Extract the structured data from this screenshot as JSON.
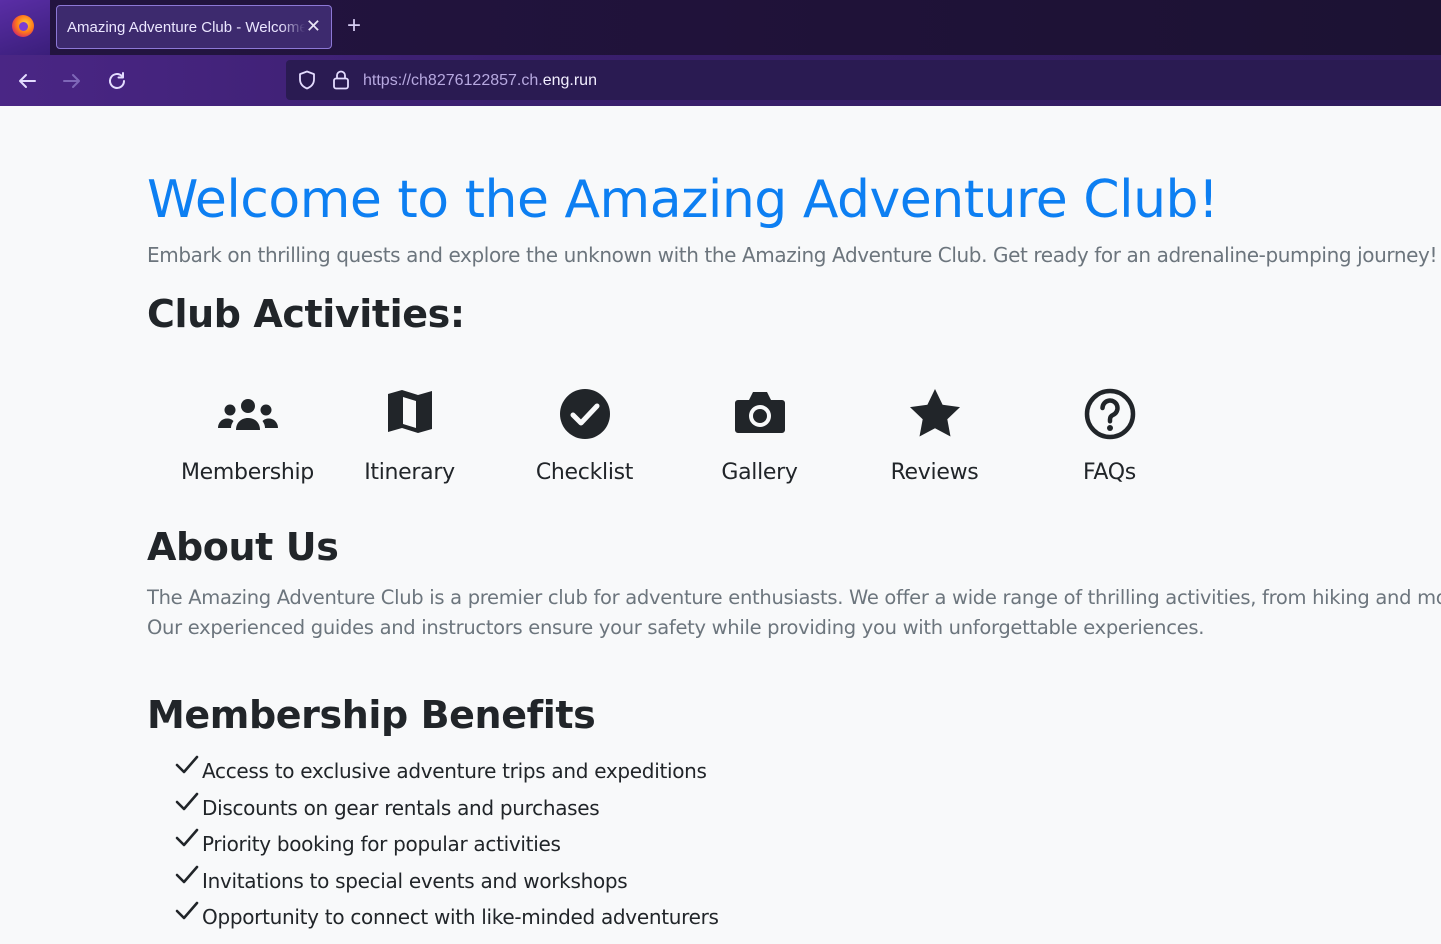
{
  "browser": {
    "tab_title": "Amazing Adventure Club - Welcome",
    "tab_close": "✕",
    "new_tab": "+",
    "url_prefix": "https://ch8276122857.ch.",
    "url_domain": "eng.run"
  },
  "hero": {
    "title": "Welcome to the Amazing Adventure Club!",
    "lead": "Embark on thrilling quests and explore the unknown with the Amazing Adventure Club. Get ready for an adrenaline-pumping journey!"
  },
  "activities": {
    "heading": "Club Activities:",
    "items": [
      {
        "label": "Membership",
        "icon": "users-icon"
      },
      {
        "label": "Itinerary",
        "icon": "map-icon"
      },
      {
        "label": "Checklist",
        "icon": "check-circle-icon"
      },
      {
        "label": "Gallery",
        "icon": "camera-icon"
      },
      {
        "label": "Reviews",
        "icon": "star-icon"
      },
      {
        "label": "FAQs",
        "icon": "question-circle-icon"
      }
    ]
  },
  "about": {
    "heading": "About Us",
    "line1": "The Amazing Adventure Club is a premier club for adventure enthusiasts. We offer a wide range of thrilling activities, from hiking and mountaineering",
    "line2": "Our experienced guides and instructors ensure your safety while providing you with unforgettable experiences."
  },
  "benefits": {
    "heading": "Membership Benefits",
    "items": [
      "Access to exclusive adventure trips and expeditions",
      "Discounts on gear rentals and purchases",
      "Priority booking for popular activities",
      "Invitations to special events and workshops",
      "Opportunity to connect with like-minded adventurers"
    ]
  },
  "colors": {
    "accent": "#0d7ff2",
    "muted_text": "#6c757d",
    "body_text": "#212529",
    "page_bg": "#f8f9fa"
  }
}
